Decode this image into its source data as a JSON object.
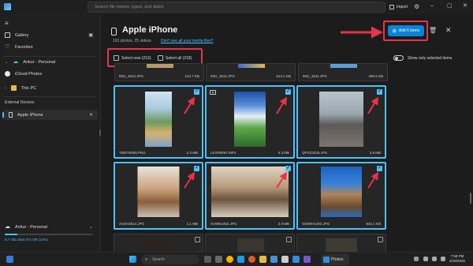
{
  "titlebar": {
    "search_placeholder": "Search file names, types, and dates",
    "import_label": "Import",
    "minimize": "–",
    "maximize": "▢",
    "close": "✕"
  },
  "sidebar": {
    "items": [
      {
        "label": "Gallery",
        "icon": "gallery-icon",
        "pin": "▣"
      },
      {
        "label": "Favorites",
        "icon": "heart-icon"
      },
      {
        "label": "Ankur - Personal",
        "icon": "cloud-icon",
        "chevron": "⌄"
      },
      {
        "label": "iCloud Photos",
        "icon": "icloud-icon"
      },
      {
        "label": "This PC",
        "icon": "folder-icon",
        "chevron": "›"
      },
      {
        "label": "Apple iPhone",
        "icon": "phone-icon",
        "close": "✕"
      }
    ],
    "section_heading": "External Devices",
    "storage": {
      "account": "Ankur - Personal",
      "chevron": "⌄",
      "text": "0.7 GB used of 5 GB (14%)",
      "used_fraction": 0.14
    }
  },
  "main": {
    "title": "Apple iPhone",
    "subtitle": "193 photos, 25 videos",
    "media_link": "Don't see all your media files?",
    "add_button": "Add 6 items",
    "select_new": "Select new (216)",
    "select_all": "Select all (218)",
    "show_selected": "Show only selected items",
    "top_row": [
      {
        "name": "IMG_3513.JPG",
        "size": "122.7 KB"
      },
      {
        "name": "IMG_3512.JPG",
        "size": "614.1 KB"
      },
      {
        "name": "IMG_3511.JPG",
        "size": "286.5 KB"
      }
    ],
    "row1": [
      {
        "name": "TMDY9405.PNG",
        "size": "2.3 MB",
        "selected": true
      },
      {
        "name": "LKVR9097.MP4",
        "size": "5.3 MB",
        "selected": true,
        "video": true
      },
      {
        "name": "QPVZ3225.JPG",
        "size": "3.8 MB",
        "selected": true
      }
    ],
    "row2": [
      {
        "name": "AHZH3514.JPG",
        "size": "1.1 MB",
        "selected": true
      },
      {
        "name": "XAWN2452.JPG",
        "size": "2.9 MB",
        "selected": true
      },
      {
        "name": "GWWH1292.JPG",
        "size": "843.1 KB",
        "selected": true
      }
    ]
  },
  "taskbar": {
    "search": "Search",
    "photos": "Photos",
    "time": "7:58 PM",
    "date": "2/18/2025"
  },
  "colors": {
    "accent": "#4cc2ff",
    "button": "#0a84d8",
    "highlight": "#e8334a"
  }
}
